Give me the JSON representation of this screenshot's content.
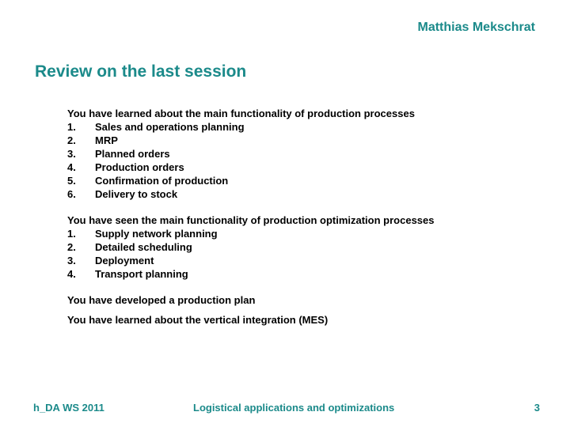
{
  "header": {
    "author": "Matthias Mekschrat"
  },
  "slide": {
    "title": "Review on the last session",
    "blocks": [
      {
        "intro": "You have learned about the main functionality of production processes",
        "items": [
          {
            "num": "1.",
            "text": "Sales and operations planning"
          },
          {
            "num": "2.",
            "text": "MRP"
          },
          {
            "num": "3.",
            "text": "Planned orders"
          },
          {
            "num": "4.",
            "text": "Production orders"
          },
          {
            "num": "5.",
            "text": "Confirmation of production"
          },
          {
            "num": "6.",
            "text": "Delivery to stock"
          }
        ]
      },
      {
        "intro": "You have seen the main functionality of production optimization processes",
        "items": [
          {
            "num": "1.",
            "text": "Supply network planning"
          },
          {
            "num": "2.",
            "text": "Detailed scheduling"
          },
          {
            "num": "3.",
            "text": "Deployment"
          },
          {
            "num": "4.",
            "text": "Transport planning"
          }
        ]
      },
      {
        "intro": "You have developed a production plan",
        "items": []
      },
      {
        "intro": "You have learned about the vertical integration (MES)",
        "items": []
      }
    ]
  },
  "footer": {
    "left": "h_DA WS 2011",
    "center": "Logistical applications and optimizations",
    "page_number": "3"
  },
  "colors": {
    "accent": "#1b8a8a",
    "text": "#000000",
    "background": "#ffffff"
  }
}
